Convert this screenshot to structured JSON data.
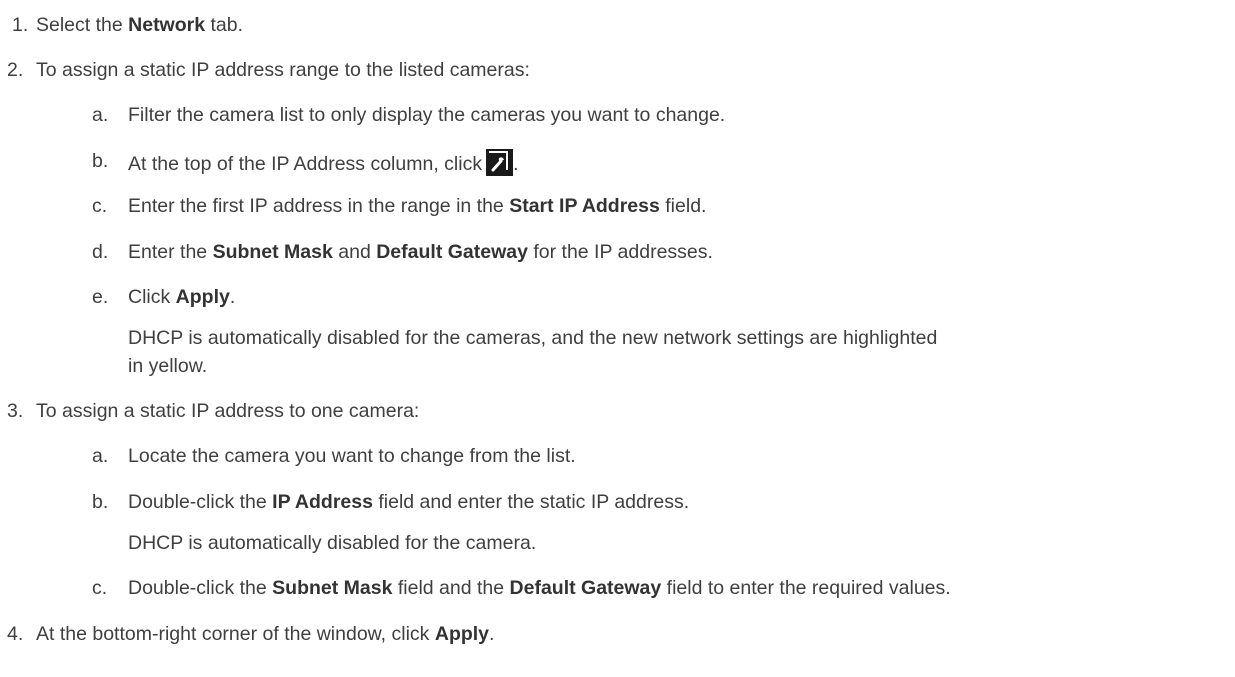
{
  "steps": [
    {
      "number": "1.",
      "before": "Select the ",
      "bold": "Network",
      "after": " tab."
    },
    {
      "number": "2.",
      "text": "To assign a static IP address range to the listed cameras:",
      "substeps": [
        {
          "letter": "a.",
          "text": "Filter the camera list to only display the cameras you want to change."
        },
        {
          "letter": "b.",
          "before": "At the top of the IP Address column, click",
          "icon": "wrench-icon",
          "after": "."
        },
        {
          "letter": "c.",
          "before": "Enter the first IP address in the range in the ",
          "bold": "Start IP Address",
          "after": " field."
        },
        {
          "letter": "d.",
          "before": "Enter the ",
          "bold1": "Subnet Mask",
          "middle": " and ",
          "bold2": "Default Gateway",
          "after": " for the IP addresses."
        },
        {
          "letter": "e.",
          "before": "Click ",
          "bold": "Apply",
          "after": ".",
          "note_line1": "DHCP is automatically disabled for the cameras, and the new network settings are highlighted",
          "note_line2": "in yellow."
        }
      ]
    },
    {
      "number": "3.",
      "text": "To assign a static IP address to one camera:",
      "substeps": [
        {
          "letter": "a.",
          "text": "Locate the camera you want to change from the list."
        },
        {
          "letter": "b.",
          "before": "Double-click the ",
          "bold": "IP Address",
          "after": " field and enter the static IP address.",
          "note": "DHCP is automatically disabled for the camera."
        },
        {
          "letter": "c.",
          "before": "Double-click the ",
          "bold1": "Subnet Mask",
          "middle": " field and the ",
          "bold2": "Default Gateway",
          "after": " field to enter the required values."
        }
      ]
    },
    {
      "number": "4.",
      "before": "At the bottom-right corner of the window, click ",
      "bold": "Apply",
      "after": "."
    }
  ]
}
